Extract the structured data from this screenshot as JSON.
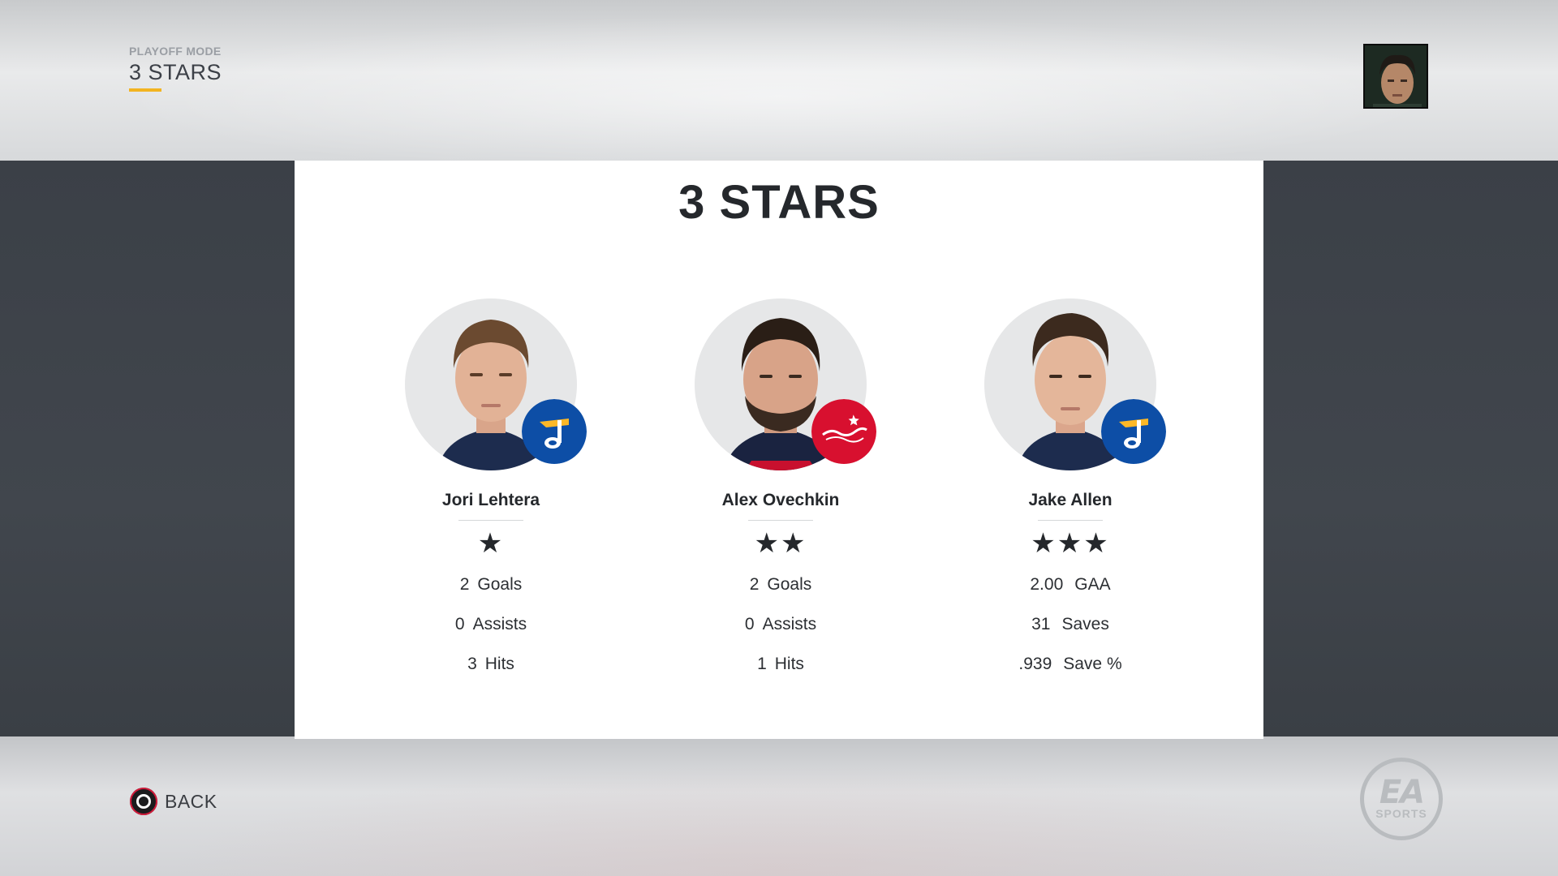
{
  "header": {
    "mode_label": "PLAYOFF MODE",
    "page_title": "3 STARS"
  },
  "panel": {
    "title": "3 STARS"
  },
  "players": [
    {
      "name": "Jori Lehtera",
      "stars": "★",
      "team_color": "#0d4ea6",
      "stats": [
        {
          "value": "2",
          "label": "Goals"
        },
        {
          "value": "0",
          "label": "Assists"
        },
        {
          "value": "3",
          "label": "Hits"
        }
      ]
    },
    {
      "name": "Alex Ovechkin",
      "stars": "★★",
      "team_color": "#d8102f",
      "stats": [
        {
          "value": "2",
          "label": "Goals"
        },
        {
          "value": "0",
          "label": "Assists"
        },
        {
          "value": "1",
          "label": "Hits"
        }
      ]
    },
    {
      "name": "Jake Allen",
      "stars": "★★★",
      "team_color": "#0d4ea6",
      "stats": [
        {
          "value": "2.00",
          "label": "GAA"
        },
        {
          "value": "31",
          "label": "Saves"
        },
        {
          "value": ".939",
          "label": "Save %"
        }
      ]
    }
  ],
  "footer": {
    "back_label": "BACK",
    "brand_mark": "EA",
    "brand_sub": "SPORTS"
  },
  "icons": {
    "profile": "profile-avatar",
    "back": "circle-button-icon",
    "brand": "ea-sports-logo"
  }
}
